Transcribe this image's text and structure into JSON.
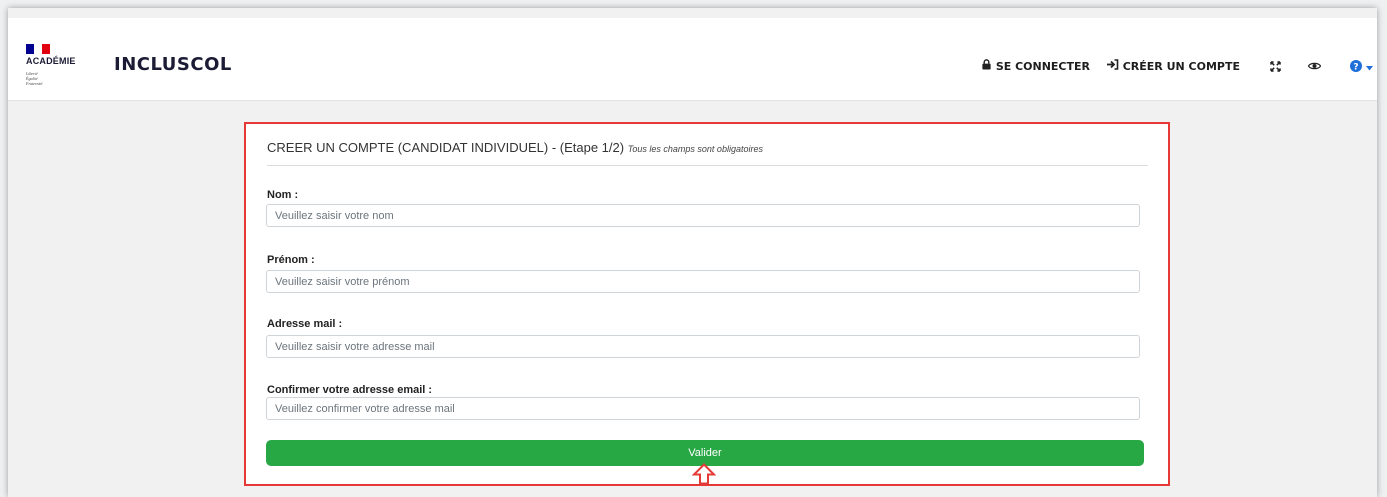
{
  "header": {
    "logo_text": "ACADÉMIE",
    "motto": [
      "Liberté",
      "Égalité",
      "Fraternité"
    ],
    "app_title": "INCLUSCOL",
    "nav": {
      "login_label": "SE CONNECTER",
      "create_account_label": "CRÉER UN COMPTE"
    }
  },
  "form": {
    "title": "CREER UN COMPTE (CANDIDAT INDIVIDUEL) - ",
    "step": "(Etape 1/2)",
    "note": "Tous les champs sont obligatoires",
    "fields": [
      {
        "label": "Nom :",
        "placeholder": "Veuillez saisir votre nom",
        "value": ""
      },
      {
        "label": "Prénom :",
        "placeholder": "Veuillez saisir votre prénom",
        "value": ""
      },
      {
        "label": "Adresse mail :",
        "placeholder": "Veuillez saisir votre adresse mail",
        "value": ""
      },
      {
        "label": "Confirmer votre adresse email :",
        "placeholder": "Veuillez confirmer votre adresse mail",
        "value": ""
      }
    ],
    "submit_label": "Valider"
  },
  "colors": {
    "accent_green": "#28a745",
    "highlight_red": "#e53935",
    "flag_blue": "#000091",
    "flag_red": "#e1000f",
    "help_blue": "#1e6fd9"
  },
  "icons": [
    "lock-icon",
    "sign-in-icon",
    "expand-icon",
    "eye-icon",
    "help-icon",
    "chevron-down-icon",
    "up-arrow-icon"
  ]
}
